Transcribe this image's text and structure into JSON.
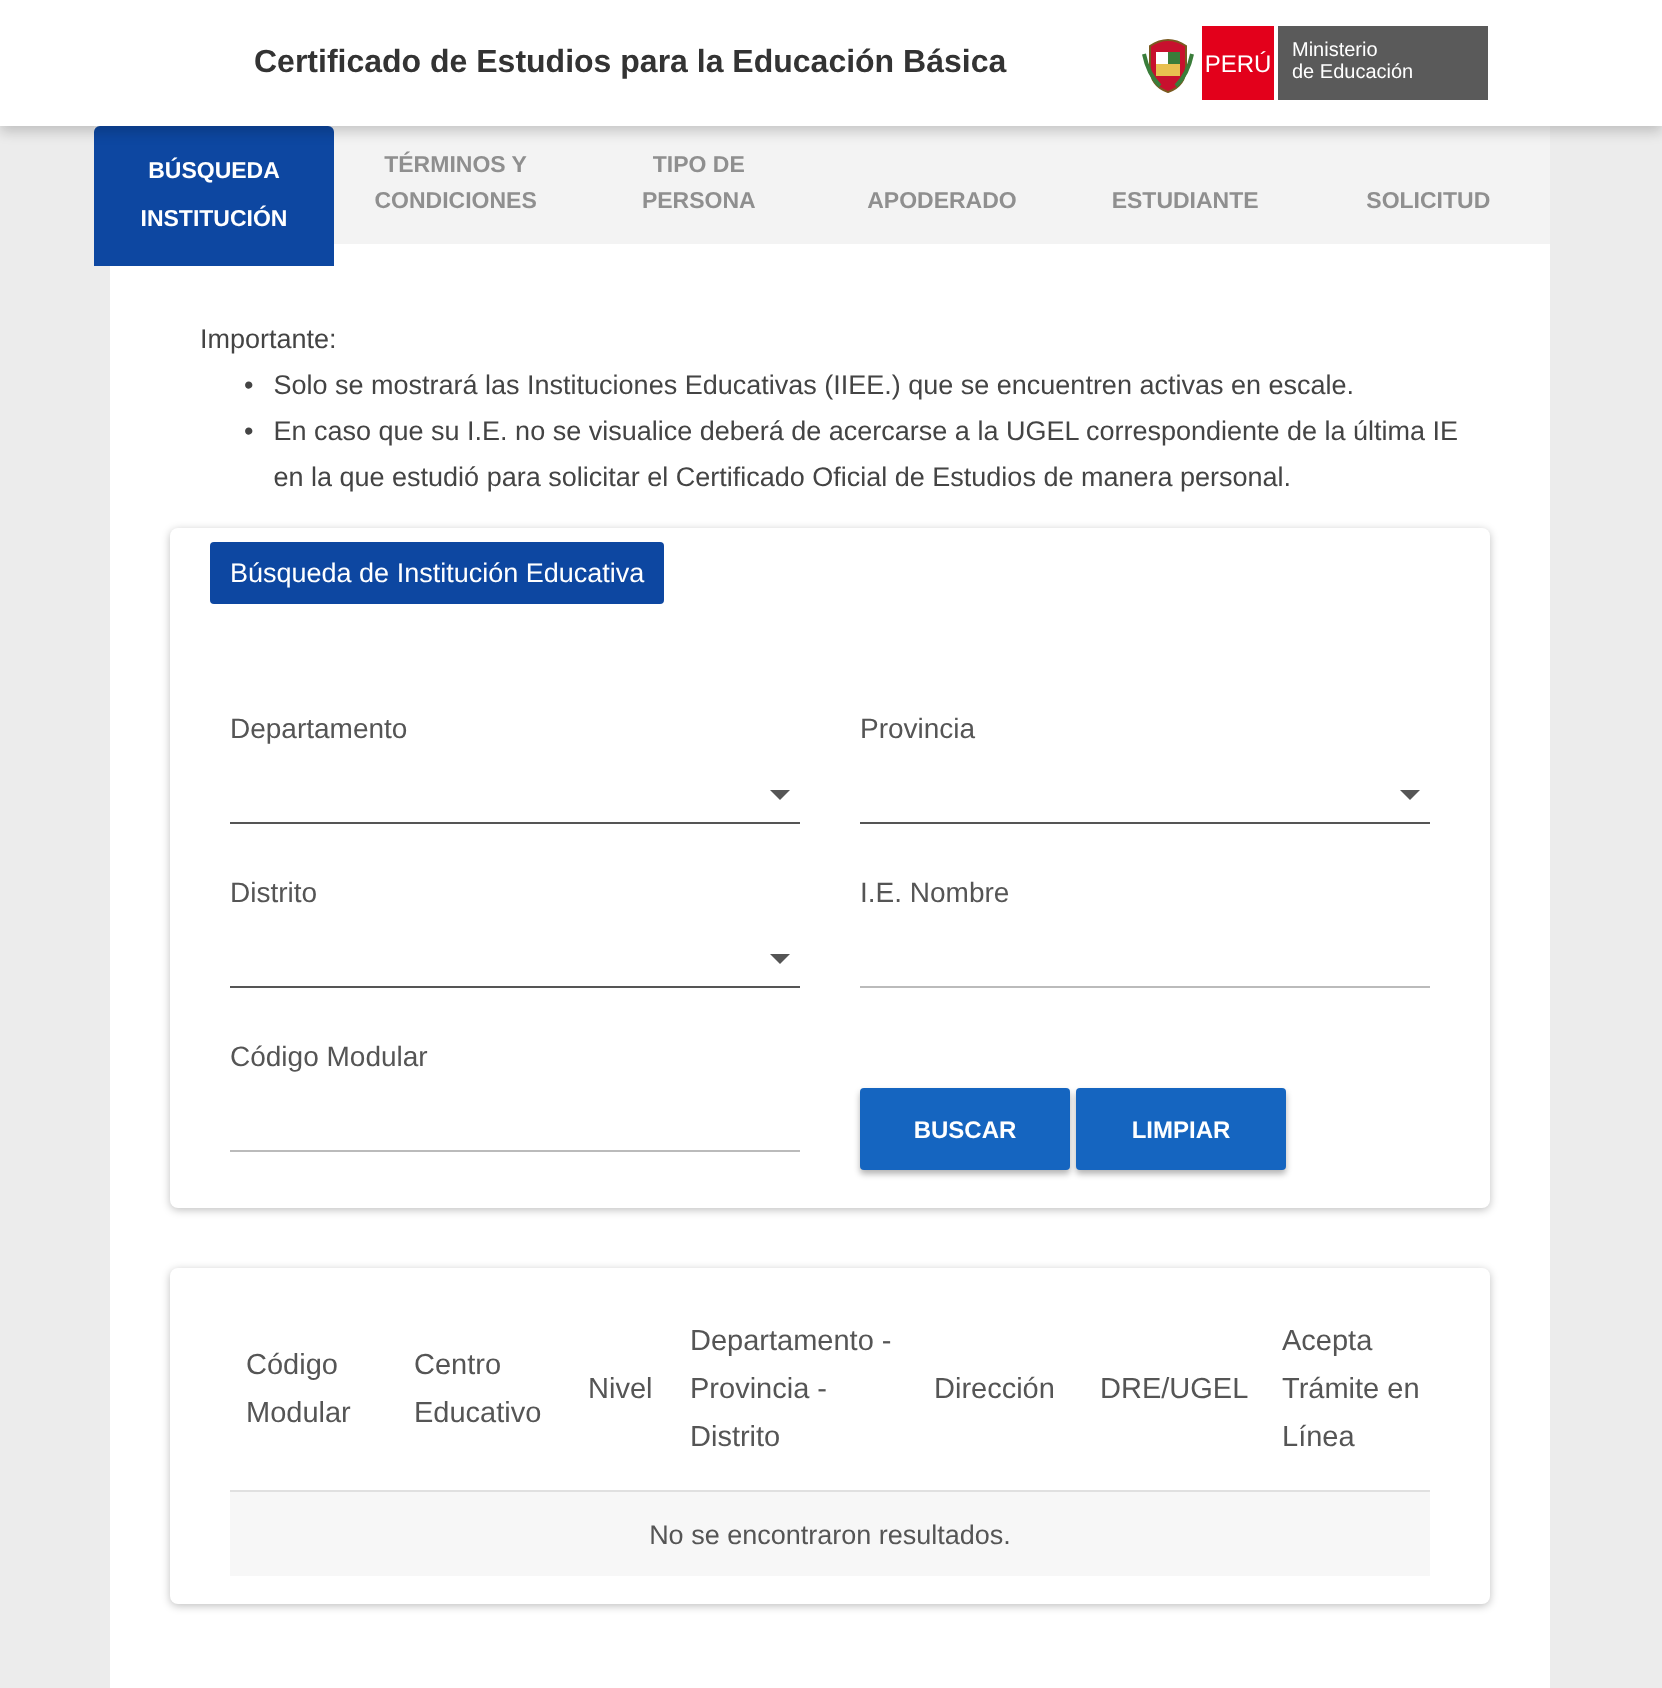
{
  "header": {
    "title": "Certificado de Estudios para la Educación Básica",
    "logo": {
      "country": "PERÚ",
      "ministry_line_1": "Ministerio",
      "ministry_line_2": "de Educación"
    }
  },
  "steps": [
    {
      "label": "BÚSQUEDA INSTITUCIÓN",
      "selected": true
    },
    {
      "label": "TÉRMINOS Y CONDICIONES",
      "selected": false
    },
    {
      "label": "TIPO DE PERSONA",
      "selected": false
    },
    {
      "label": "APODERADO",
      "selected": false
    },
    {
      "label": "ESTUDIANTE",
      "selected": false
    },
    {
      "label": "SOLICITUD",
      "selected": false
    }
  ],
  "notice": {
    "heading": "Importante:",
    "items": [
      {
        "marker": "•",
        "text": "Solo se mostrará las Instituciones Educativas (IIEE.) que se encuentren activas en escale."
      },
      {
        "marker": "•",
        "text": "En caso que su I.E. no se visualice deberá de acercarse a la UGEL correspondiente de la última IE en la que estudió para solicitar el Certificado Oficial de Estudios de manera personal."
      }
    ]
  },
  "search_form": {
    "title": "Búsqueda de Institución Educativa",
    "fields": [
      {
        "label": "Departamento",
        "kind": "select"
      },
      {
        "label": "Provincia",
        "kind": "select"
      },
      {
        "label": "Distrito",
        "kind": "select"
      },
      {
        "label": "I.E. Nombre",
        "kind": "text"
      },
      {
        "label": "Código Modular",
        "kind": "text"
      }
    ],
    "buttons": [
      "BUSCAR",
      "LIMPIAR"
    ]
  },
  "results_table": {
    "columns": [
      "Código Modular",
      "Centro Educativo",
      "Nivel",
      "Departamento - Provincia - Distrito",
      "Dirección",
      "DRE/UGEL",
      "Acepta Trámite en Línea"
    ],
    "empty_message": "No se encontraron resultados."
  }
}
